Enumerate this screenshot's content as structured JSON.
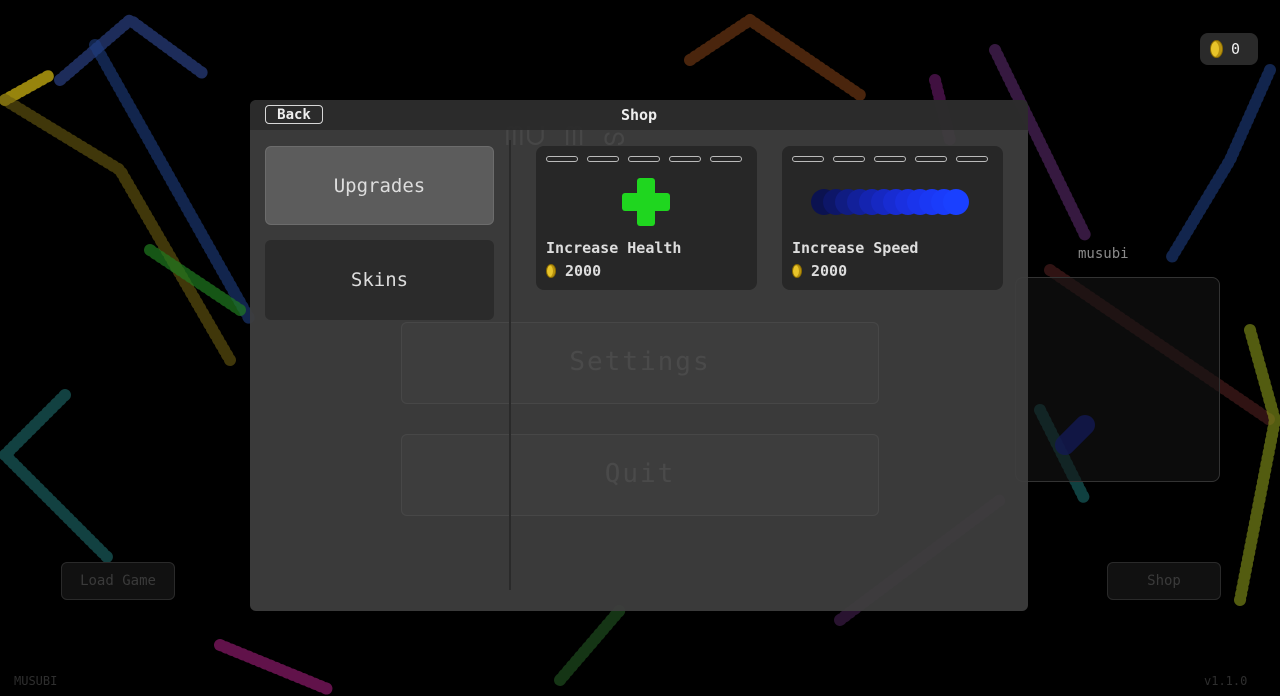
{
  "hud": {
    "coins": "0"
  },
  "background": {
    "title_ghost": "ᗰᑌ ᗰ ᔕ",
    "player_name": "musubi",
    "settings_label": "Settings",
    "quit_label": "Quit",
    "load_game_label": "Load Game",
    "shop_label": "Shop",
    "author": "MUSUBI",
    "version": "v1.1.0"
  },
  "shop": {
    "back_label": "Back",
    "title": "Shop",
    "categories": [
      "Upgrades",
      "Skins"
    ],
    "items": [
      {
        "name": "Increase Health",
        "price": "2000",
        "level": 0,
        "max_level": 5,
        "icon": "green-plus-icon"
      },
      {
        "name": "Increase Speed",
        "price": "2000",
        "level": 0,
        "max_level": 5,
        "icon": "blue-snake-icon"
      }
    ]
  },
  "colors": {
    "health": "#1fd61f",
    "speed": "#1a3cff",
    "coin": "#e8c42a"
  }
}
